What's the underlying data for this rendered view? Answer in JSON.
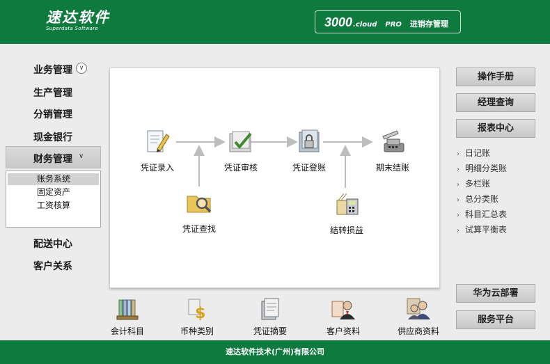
{
  "header": {
    "logo_cn": "速达软件",
    "logo_en": "Superdata Software",
    "product_num": "3000",
    "product_cloud": ".cloud",
    "product_edition": "PRO",
    "product_module": "进销存管理"
  },
  "nav": {
    "items": [
      {
        "label": "业务管理"
      },
      {
        "label": "生产管理"
      },
      {
        "label": "分销管理"
      },
      {
        "label": "现金银行"
      },
      {
        "label": "财务管理"
      },
      {
        "label": "配送中心"
      },
      {
        "label": "客户关系"
      }
    ],
    "submenu": [
      {
        "label": "账务系统",
        "selected": true
      },
      {
        "label": "固定资产",
        "selected": false
      },
      {
        "label": "工资核算",
        "selected": false
      }
    ]
  },
  "flow": {
    "nodes": [
      {
        "label": "凭证录入",
        "icon": "voucher-entry-icon"
      },
      {
        "label": "凭证审核",
        "icon": "voucher-audit-icon"
      },
      {
        "label": "凭证登账",
        "icon": "voucher-posting-icon"
      },
      {
        "label": "期末结账",
        "icon": "period-close-icon"
      },
      {
        "label": "凭证查找",
        "icon": "voucher-search-icon"
      },
      {
        "label": "结转损益",
        "icon": "profit-loss-transfer-icon"
      }
    ]
  },
  "tools": [
    {
      "label": "会计科目",
      "icon": "accounts-icon"
    },
    {
      "label": "币种类别",
      "icon": "currency-icon"
    },
    {
      "label": "凭证摘要",
      "icon": "voucher-summary-icon"
    },
    {
      "label": "客户资料",
      "icon": "customer-icon"
    },
    {
      "label": "供应商资料",
      "icon": "supplier-icon"
    }
  ],
  "right": {
    "manual": "操作手册",
    "manager_query": "经理查询",
    "report_center": "报表中心",
    "reports": [
      "日记账",
      "明细分类账",
      "多栏账",
      "总分类账",
      "科目汇总表",
      "试算平衡表"
    ],
    "huawei": "华为云部署",
    "service": "服务平台"
  },
  "footer": {
    "text": "速达软件技术(广州)有限公司"
  },
  "colors": {
    "brand_green": "#0e7a3e",
    "arrow_gray": "#bdbdbd"
  }
}
